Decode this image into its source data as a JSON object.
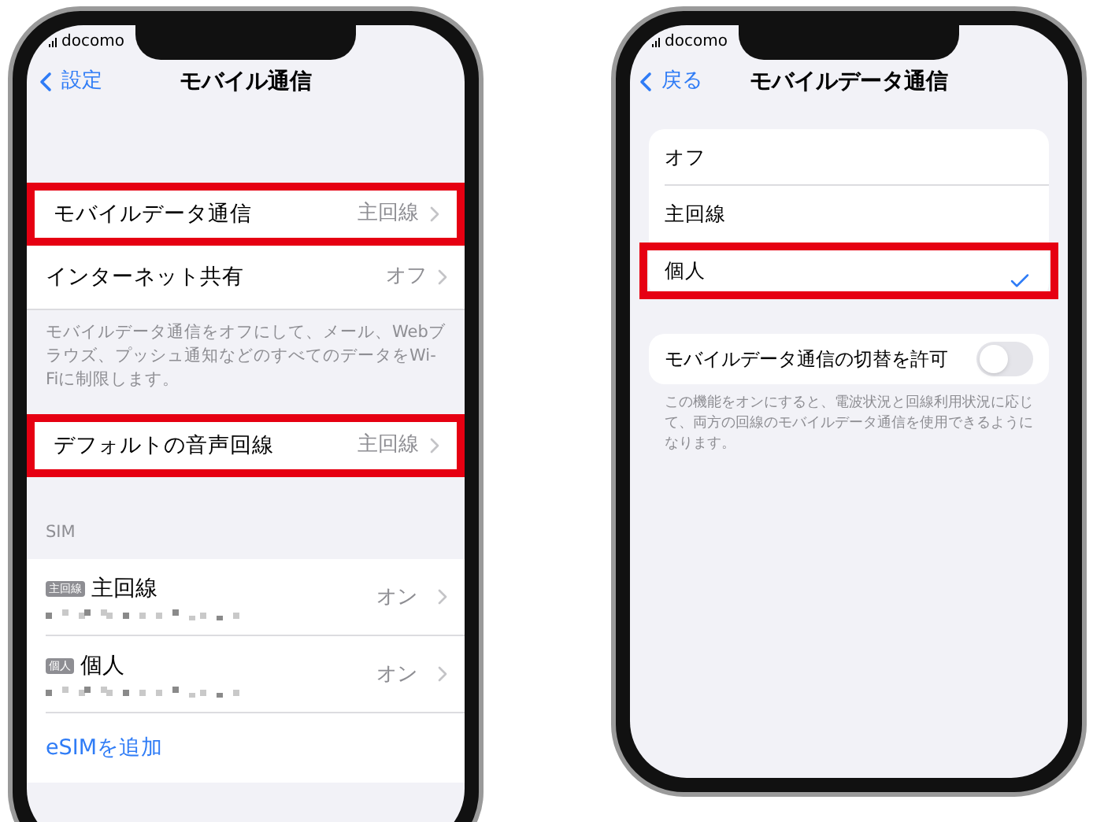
{
  "left_screen": {
    "carrier": "docomo",
    "back_label": "設定",
    "title": "モバイル通信",
    "rows": [
      {
        "label": "モバイルデータ通信",
        "value": "主回線",
        "highlighted": true
      },
      {
        "label": "インターネット共有",
        "value": "オフ",
        "highlighted": false
      }
    ],
    "footnote": "モバイルデータ通信をオフにして、メール、Webブラウズ、プッシュ通知などのすべてのデータをWi-Fiに制限します。",
    "voice_row": {
      "label": "デフォルトの音声回線",
      "value": "主回線",
      "highlighted": true
    },
    "sim_header": "SIM",
    "sim_lines": [
      {
        "badge": "主回線",
        "name": "主回線",
        "value": "オン"
      },
      {
        "badge": "個人",
        "name": "個人",
        "value": "オン"
      }
    ],
    "add_esim": "eSIMを追加"
  },
  "right_screen": {
    "carrier": "docomo",
    "back_label": "戻る",
    "title": "モバイルデータ通信",
    "options": [
      {
        "label": "オフ",
        "selected": false,
        "highlighted": false
      },
      {
        "label": "主回線",
        "selected": false,
        "highlighted": false
      },
      {
        "label": "個人",
        "selected": true,
        "highlighted": true
      }
    ],
    "toggle": {
      "label": "モバイルデータ通信の切替を許可",
      "on": false
    },
    "footnote": "この機能をオンにすると、電波状況と回線利用状況に応じて、両方の回線のモバイルデータ通信を使用できるようになります。"
  }
}
